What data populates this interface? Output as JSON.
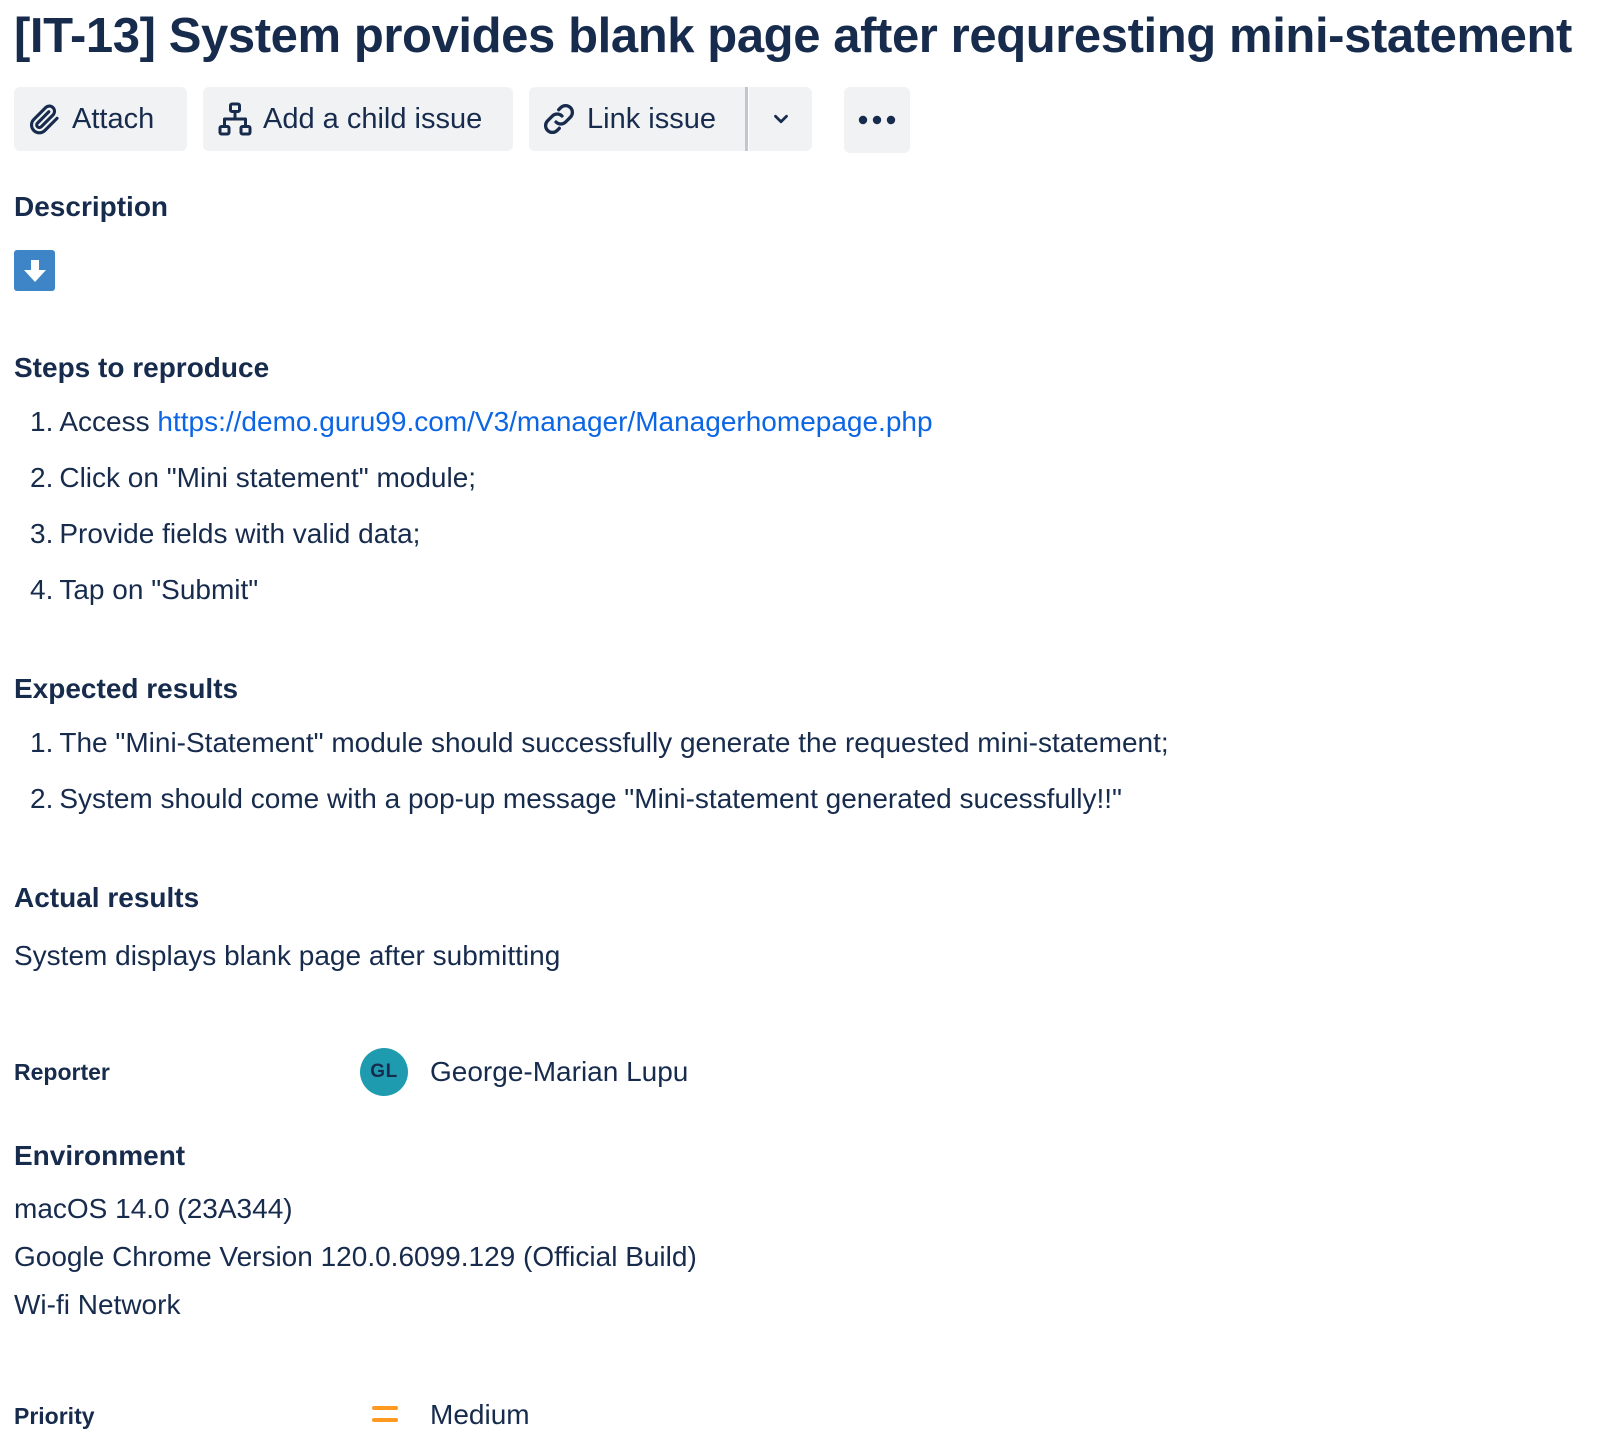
{
  "issue": {
    "title": "[IT-13] System provides blank page after requresting mini-statement"
  },
  "toolbar": {
    "attach_label": "Attach",
    "attach_icon": "paperclip-icon",
    "child_issue_label": "Add a child issue",
    "child_issue_icon": "hierarchy-icon",
    "link_issue_label": "Link issue",
    "link_issue_icon": "link-icon",
    "link_dropdown_icon": "chevron-down-icon",
    "more_icon": "more-horizontal-icon"
  },
  "description": {
    "heading": "Description",
    "icon": "arrow-down-icon",
    "icon_color": "#3d85c6",
    "steps": {
      "heading": "Steps to reproduce",
      "items": [
        {
          "num": "1.",
          "prefix": "Access ",
          "link": "https://demo.guru99.com/V3/manager/Managerhomepage.php"
        },
        {
          "num": "2.",
          "text": "Click on \"Mini statement\" module;"
        },
        {
          "num": "3.",
          "text": "Provide fields with valid data;"
        },
        {
          "num": "4.",
          "text": "Tap on \"Submit\""
        }
      ]
    },
    "expected": {
      "heading": "Expected results",
      "items": [
        {
          "num": "1.",
          "text": "The \"Mini-Statement\" module should successfully generate the requested mini-statement;"
        },
        {
          "num": "2.",
          "text": "System should come with a pop-up message \"Mini-statement generated sucessfully!!\""
        }
      ]
    },
    "actual": {
      "heading": "Actual results",
      "text": "System displays blank page after submitting"
    }
  },
  "reporter": {
    "label": "Reporter",
    "initials": "GL",
    "avatar_color": "#1f9bb0",
    "name": "George-Marian Lupu"
  },
  "environment": {
    "heading": "Environment",
    "lines": [
      "macOS 14.0 (23A344)",
      "Google Chrome Version 120.0.6099.129 (Official Build)",
      "Wi-fi Network"
    ]
  },
  "priority": {
    "label": "Priority",
    "icon": "priority-medium-icon",
    "icon_color": "#ff991f",
    "value": "Medium"
  },
  "colors": {
    "text": "#172b4d",
    "link": "#0c66e4",
    "button_bg": "#f1f2f4"
  }
}
